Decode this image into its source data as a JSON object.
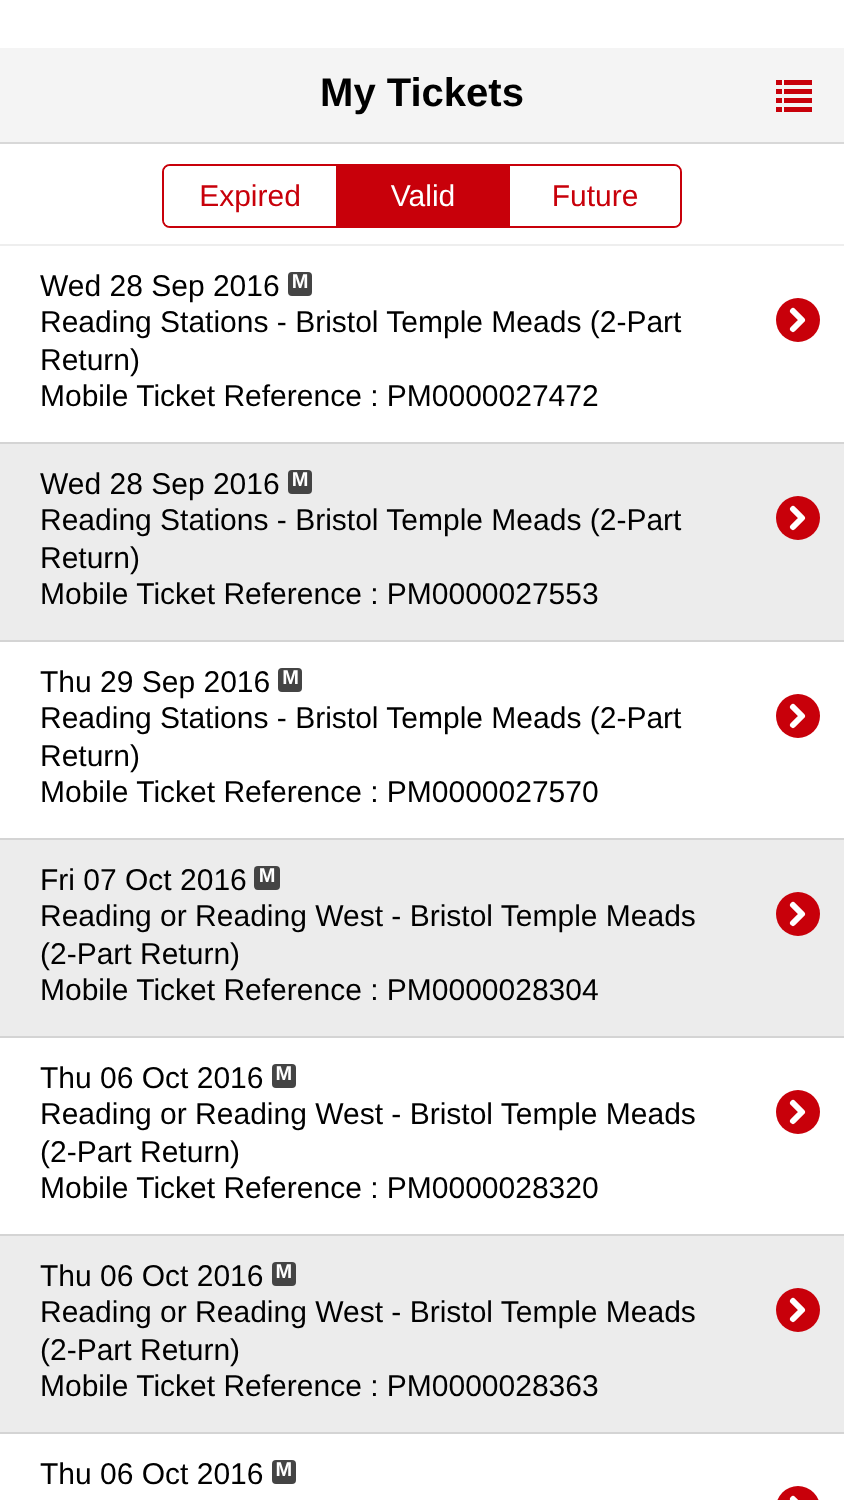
{
  "header": {
    "title": "My Tickets"
  },
  "tabs": [
    {
      "label": "Expired",
      "selected": false
    },
    {
      "label": "Valid",
      "selected": true
    },
    {
      "label": "Future",
      "selected": false
    }
  ],
  "tickets": [
    {
      "date": "Wed 28 Sep 2016",
      "badge": "M",
      "route": "Reading Stations - Bristol Temple Meads (2-Part Return)",
      "reference": "Mobile Ticket Reference : PM0000027472"
    },
    {
      "date": "Wed 28 Sep 2016",
      "badge": "M",
      "route": "Reading Stations - Bristol Temple Meads (2-Part Return)",
      "reference": "Mobile Ticket Reference : PM0000027553"
    },
    {
      "date": "Thu 29 Sep 2016",
      "badge": "M",
      "route": "Reading Stations - Bristol Temple Meads (2-Part Return)",
      "reference": "Mobile Ticket Reference : PM0000027570"
    },
    {
      "date": "Fri 07 Oct 2016",
      "badge": "M",
      "route": "Reading or Reading West - Bristol Temple Meads (2-Part Return)",
      "reference": "Mobile Ticket Reference : PM0000028304"
    },
    {
      "date": "Thu 06 Oct 2016",
      "badge": "M",
      "route": "Reading or Reading West - Bristol Temple Meads (2-Part Return)",
      "reference": "Mobile Ticket Reference : PM0000028320"
    },
    {
      "date": "Thu 06 Oct 2016",
      "badge": "M",
      "route": "Reading or Reading West - Bristol Temple Meads (2-Part Return)",
      "reference": "Mobile Ticket Reference : PM0000028363"
    },
    {
      "date": "Thu 06 Oct 2016",
      "badge": "M"
    }
  ]
}
